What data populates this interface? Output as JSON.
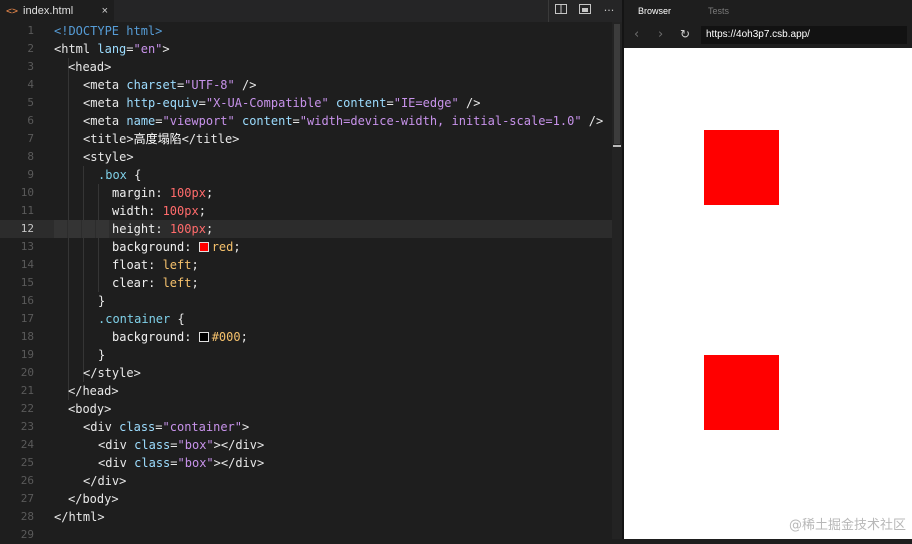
{
  "editor": {
    "tab": {
      "icon": "<>",
      "filename": "index.html",
      "close": "×"
    },
    "toolbar": {
      "split_icon": "split-editor-icon",
      "preview_icon": "preview-icon",
      "more": "···"
    },
    "active_line": 12,
    "line_numbers": [
      "1",
      "2",
      "3",
      "4",
      "5",
      "6",
      "7",
      "8",
      "9",
      "10",
      "11",
      "12",
      "13",
      "14",
      "15",
      "16",
      "17",
      "18",
      "19",
      "20",
      "21",
      "22",
      "23",
      "24",
      "25",
      "26",
      "27",
      "28",
      "29"
    ]
  },
  "code": {
    "l1": {
      "t": "<!DOCTYPE html>"
    },
    "l2": {
      "open": "<",
      "tag": "html",
      "attr": " lang",
      "eq": "=",
      "val": "\"en\"",
      "close": ">"
    },
    "l3": {
      "t": "<head>"
    },
    "l4": {
      "open": "<",
      "tag": "meta",
      "attr": " charset",
      "eq": "=",
      "val": "\"UTF-8\"",
      "close": " />"
    },
    "l5": {
      "open": "<",
      "tag": "meta",
      "attr": " http-equiv",
      "eq": "=",
      "val": "\"X-UA-Compatible\"",
      "attr2": " content",
      "eq2": "=",
      "val2": "\"IE=edge\"",
      "close": " />"
    },
    "l6": {
      "open": "<",
      "tag": "meta",
      "attr": " name",
      "eq": "=",
      "val": "\"viewport\"",
      "attr2": " content",
      "eq2": "=",
      "val2": "\"width=device-width, initial-scale=1.0\"",
      "close": " />"
    },
    "l7": {
      "open": "<title>",
      "text": "高度塌陷",
      "close": "</title>"
    },
    "l8": {
      "t": "<style>"
    },
    "l9": {
      "sel": ".box",
      "brace": " {"
    },
    "l10": {
      "prop": "margin",
      "colon": ": ",
      "val": "100px",
      "semi": ";"
    },
    "l11": {
      "prop": "width",
      "colon": ": ",
      "val": "100px",
      "semi": ";"
    },
    "l12": {
      "prop": "height",
      "colon": ": ",
      "val": "100px",
      "semi": ";"
    },
    "l13": {
      "prop": "background",
      "colon": ": ",
      "val": "red",
      "semi": ";",
      "swatch": "#ff0000"
    },
    "l14": {
      "prop": "float",
      "colon": ": ",
      "val": "left",
      "semi": ";"
    },
    "l15": {
      "prop": "clear",
      "colon": ": ",
      "val": "left",
      "semi": ";"
    },
    "l16": {
      "t": "}"
    },
    "l17": {
      "sel": ".container",
      "brace": " {"
    },
    "l18": {
      "prop": "background",
      "colon": ": ",
      "val": "#000",
      "semi": ";",
      "swatch": "#000000"
    },
    "l19": {
      "t": "}"
    },
    "l20": {
      "t": "</style>"
    },
    "l21": {
      "t": "</head>"
    },
    "l22": {
      "t": "<body>"
    },
    "l23": {
      "open": "<",
      "tag": "div",
      "attr": " class",
      "eq": "=",
      "val": "\"container\"",
      "close": ">"
    },
    "l24": {
      "open": "<",
      "tag": "div",
      "attr": " class",
      "eq": "=",
      "val": "\"box\"",
      "close": "></div>"
    },
    "l25": {
      "open": "<",
      "tag": "div",
      "attr": " class",
      "eq": "=",
      "val": "\"box\"",
      "close": "></div>"
    },
    "l26": {
      "t": "</div>"
    },
    "l27": {
      "t": "</body>"
    },
    "l28": {
      "t": "</html>"
    }
  },
  "browser": {
    "tabs": {
      "browser": "Browser",
      "tests": "Tests"
    },
    "nav": {
      "back": "‹",
      "forward": "›",
      "refresh": "↻"
    },
    "url": "https://4oh3p7.csb.app/",
    "box_color": "#ff0000",
    "boxes": 2
  },
  "watermark": "@稀土掘金技术社区"
}
